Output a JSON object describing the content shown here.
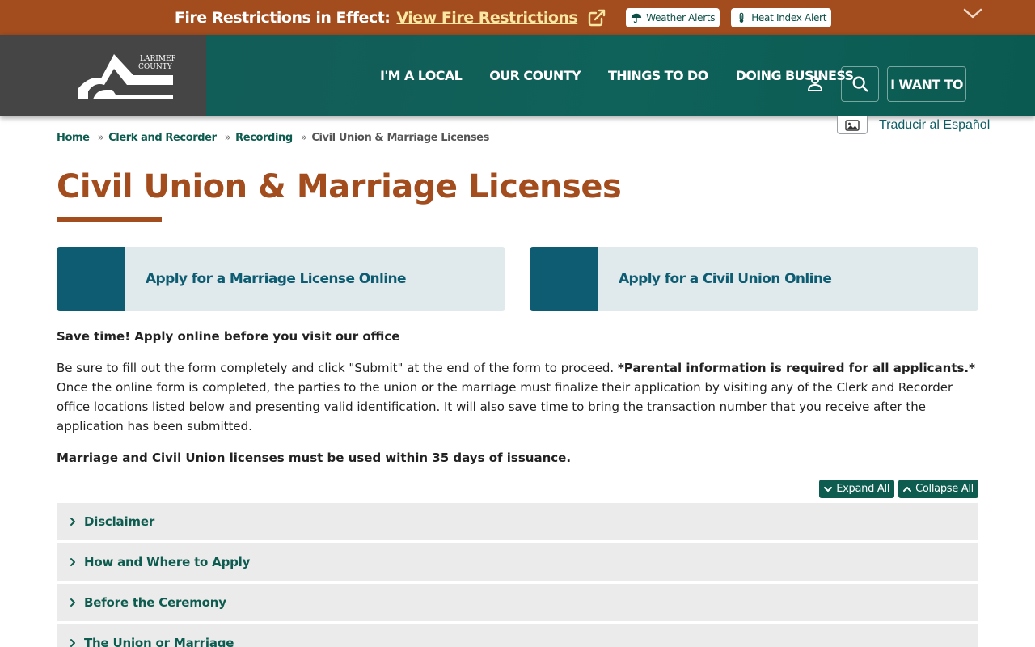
{
  "alert_bar": {
    "prefix": "Fire Restrictions in Effect:",
    "link": "View Fire Restrictions",
    "pills": [
      {
        "label": "Weather Alerts",
        "icon": "umbrella-icon"
      },
      {
        "label": "Heat Index Alert",
        "icon": "thermometer-icon"
      }
    ]
  },
  "logo": {
    "text_line1": "LARIMER",
    "text_line2": "COUNTY"
  },
  "nav": {
    "items": [
      "I'M A LOCAL",
      "OUR COUNTY",
      "THINGS TO DO",
      "DOING BUSINESS"
    ],
    "i_want_to": "I WANT TO"
  },
  "translate": {
    "label": "Traducir al Español"
  },
  "breadcrumb": {
    "links": [
      "Home",
      "Clerk and Recorder",
      "Recording"
    ],
    "separator": "»",
    "current": "Civil Union & Marriage Licenses"
  },
  "page": {
    "title": "Civil Union & Marriage Licenses"
  },
  "cards": [
    {
      "label": "Apply for a Marriage License Online"
    },
    {
      "label": "Apply for a Civil Union Online"
    }
  ],
  "content": {
    "p1": "Save time! Apply online before you visit our office",
    "p2_a": "Be sure to fill out the form completely and click \"Submit\" at the end of the form to proceed. ",
    "p2_b": "*Parental information is required for all applicants.*",
    "p2_c": " Once the online form is completed, the parties to the union or the marriage must finalize their application by visiting any of the Clerk and Recorder office locations listed below and presenting valid identification. It will also save time to bring the transaction number that you receive after the application has been submitted.",
    "p3": "Marriage and Civil Union licenses must be used within 35 days of issuance."
  },
  "controls": {
    "expand_all": "Expand All",
    "collapse_all": "Collapse All"
  },
  "accordion": [
    {
      "label": "Disclaimer"
    },
    {
      "label": "How and Where to Apply"
    },
    {
      "label": "Before the Ceremony"
    },
    {
      "label": "The Union or Marriage"
    }
  ],
  "colors": {
    "alert_bg": "#a34d1e",
    "header_teal": "#0f5e57",
    "accent_rust": "#a34d1e",
    "card_blue": "#0d5c72",
    "link_green": "#0d5c4f"
  }
}
